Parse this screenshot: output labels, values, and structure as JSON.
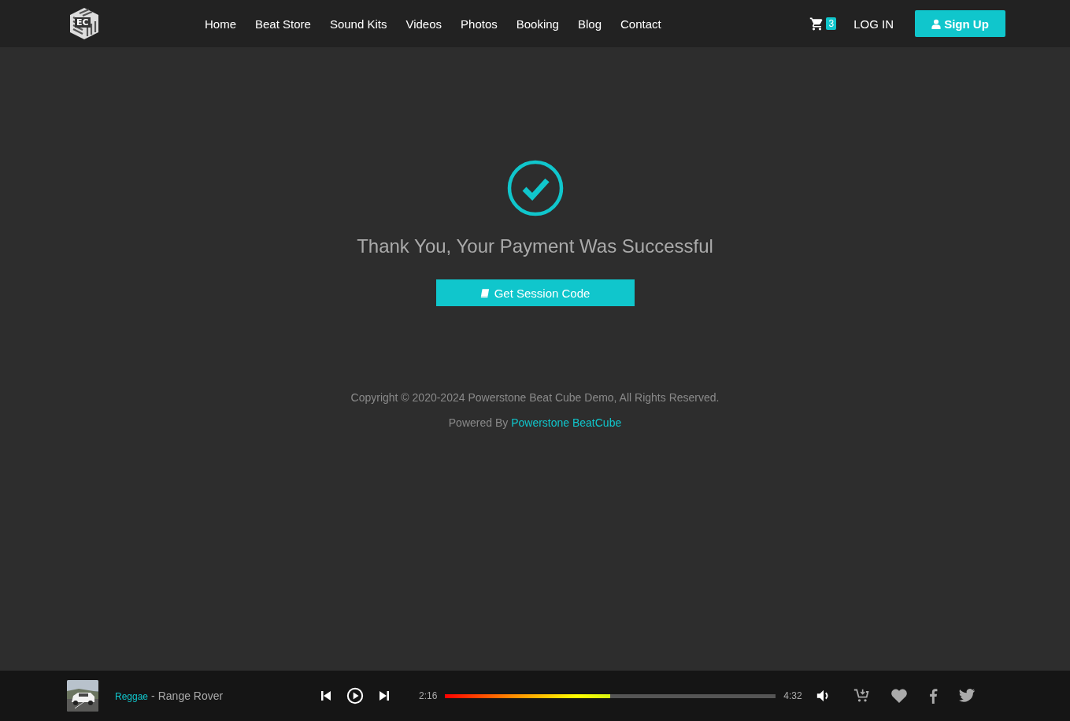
{
  "header": {
    "logo": {
      "text": "EC"
    },
    "nav": [
      {
        "label": "Home"
      },
      {
        "label": "Beat Store"
      },
      {
        "label": "Sound Kits"
      },
      {
        "label": "Videos"
      },
      {
        "label": "Photos"
      },
      {
        "label": "Booking"
      },
      {
        "label": "Blog"
      },
      {
        "label": "Contact"
      }
    ],
    "cart": {
      "count": "3"
    },
    "login": "LOG IN",
    "signup": "Sign Up"
  },
  "main": {
    "title": "Thank You, Your Payment Was Successful",
    "button": "Get Session Code"
  },
  "footer": {
    "copyright": "Copyright © 2020-2024 Powerstone Beat Cube Demo, All Rights Reserved.",
    "powered_by": "Powered By",
    "powered_link": "Powerstone BeatCube"
  },
  "player": {
    "genre": "Reggae",
    "separator": "-",
    "track": "Range Rover",
    "elapsed": "2:16",
    "progress": {
      "level": 0.5
    },
    "duration": "4:32"
  }
}
